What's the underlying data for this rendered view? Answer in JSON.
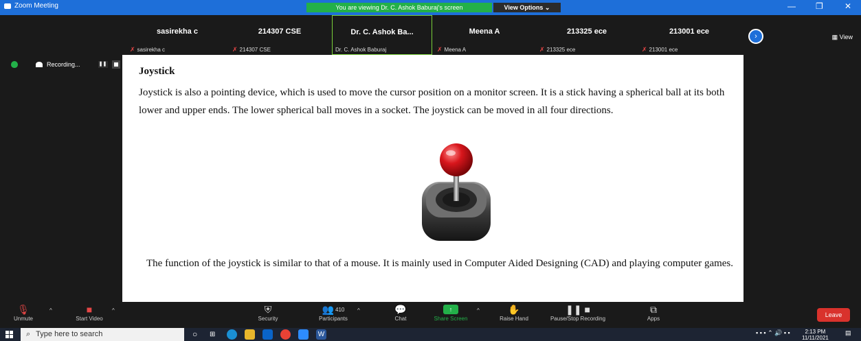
{
  "window": {
    "title": "Zoom Meeting",
    "banner": "You are viewing Dr. C. Ashok Baburaj's screen",
    "view_options": "View Options ⌄",
    "view": "View"
  },
  "participants": [
    {
      "name": "sasirekha c",
      "tag": "sasirekha c",
      "muted": true
    },
    {
      "name": "214307 CSE",
      "tag": "214307 CSE",
      "muted": true
    },
    {
      "name": "Dr. C. Ashok Ba...",
      "tag": "Dr. C. Ashok Baburaj",
      "muted": false
    },
    {
      "name": "Meena A",
      "tag": "Meena A",
      "muted": true
    },
    {
      "name": "213325 ece",
      "tag": "213325 ece",
      "muted": true
    },
    {
      "name": "213001 ece",
      "tag": "213001 ece",
      "muted": true
    }
  ],
  "recording": {
    "label": "Recording..."
  },
  "document": {
    "heading": "Joystick",
    "paragraph1": "Joystick is also a pointing device, which is used to move the cursor position on a monitor screen. It is a stick having a spherical ball at its both lower and upper ends. The lower spherical ball moves in a socket. The joystick can be moved in all four directions.",
    "paragraph2": "The function of the joystick is similar to that of a mouse. It is mainly used in Computer Aided Designing (CAD) and playing computer games."
  },
  "toolbar": {
    "unmute": "Unmute",
    "start_video": "Start Video",
    "security": "Security",
    "participants": "Participants",
    "participant_count": "410",
    "chat": "Chat",
    "share_screen": "Share Screen",
    "raise_hand": "Raise Hand",
    "pause_stop_recording": "Pause/Stop Recording",
    "apps": "Apps",
    "leave": "Leave"
  },
  "taskbar": {
    "search_placeholder": "Type here to search",
    "time": "2:13 PM",
    "date": "11/11/2021"
  },
  "colors": {
    "zoom_blue": "#1e6fd9",
    "share_green": "#23b049",
    "leave_red": "#d9322c"
  }
}
